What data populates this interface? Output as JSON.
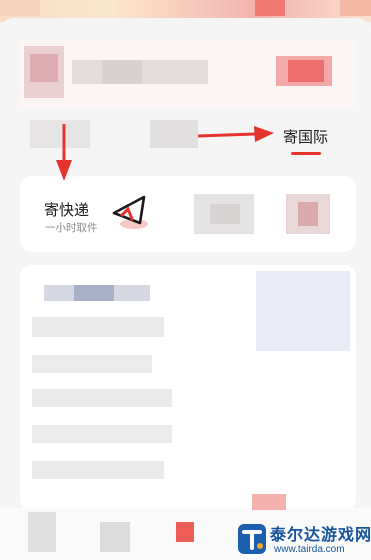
{
  "tabs": {
    "international_label": "寄国际"
  },
  "express": {
    "title": "寄快递",
    "subtitle": "一小时取件",
    "icon": "paper-plane-icon"
  },
  "annotations": {
    "arrow_color": "#e4342d"
  },
  "watermark": {
    "name": "泰尔达游戏网",
    "url": "www.tairda.com"
  },
  "colors": {
    "accent": "#e4342d",
    "watermark": "#15539c"
  }
}
